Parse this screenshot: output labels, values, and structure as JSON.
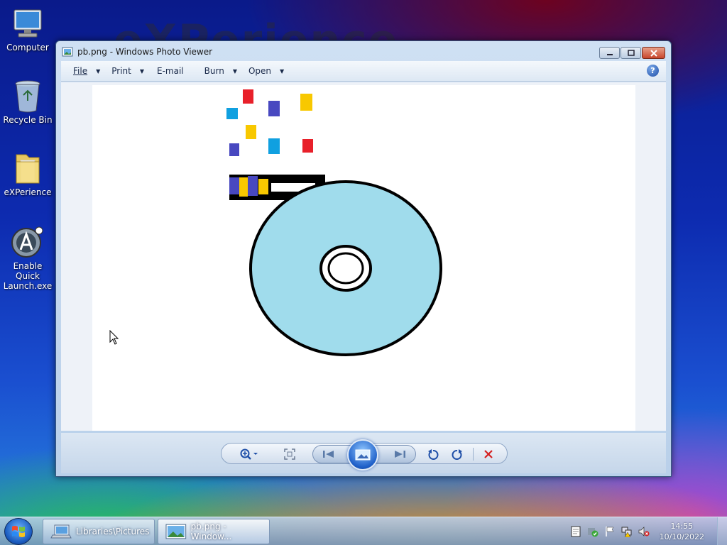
{
  "desktop": {
    "icons": [
      {
        "label": "Computer",
        "icon": "computer-icon"
      },
      {
        "label": "Recycle Bin",
        "icon": "recycle-bin-icon"
      },
      {
        "label": "eXPerience",
        "icon": "folder-icon"
      },
      {
        "label": "Enable Quick Launch.exe",
        "icon": "quick-launch-icon"
      }
    ],
    "watermark": "eXPerience"
  },
  "window": {
    "title": "pb.png - Windows Photo Viewer",
    "menu": [
      {
        "label": "File",
        "has_dropdown": true
      },
      {
        "label": "Print",
        "has_dropdown": true
      },
      {
        "label": "E-mail",
        "has_dropdown": false
      },
      {
        "label": "Burn",
        "has_dropdown": true
      },
      {
        "label": "Open",
        "has_dropdown": true
      }
    ],
    "help": "?",
    "controls": {
      "zoom": "zoom-icon",
      "fit": "actual-size-icon",
      "previous": "previous-icon",
      "slideshow": "slideshow-icon",
      "next": "next-icon",
      "rotate_ccw": "rotate-counterclockwise-icon",
      "rotate_cw": "rotate-clockwise-icon",
      "delete": "delete-icon"
    }
  },
  "colors": {
    "disc": "#a0dcec",
    "red": "#e8202a",
    "blue": "#4848c0",
    "cyan": "#10a0e0",
    "yellow": "#f8c800",
    "delete_red": "#d42020"
  },
  "taskbar": {
    "buttons": [
      {
        "label": "Libraries\\Pictures",
        "active": false
      },
      {
        "label": "pb.png - Window...",
        "active": true
      }
    ],
    "clock_time": "14:55",
    "clock_date": "10/10/2022"
  }
}
